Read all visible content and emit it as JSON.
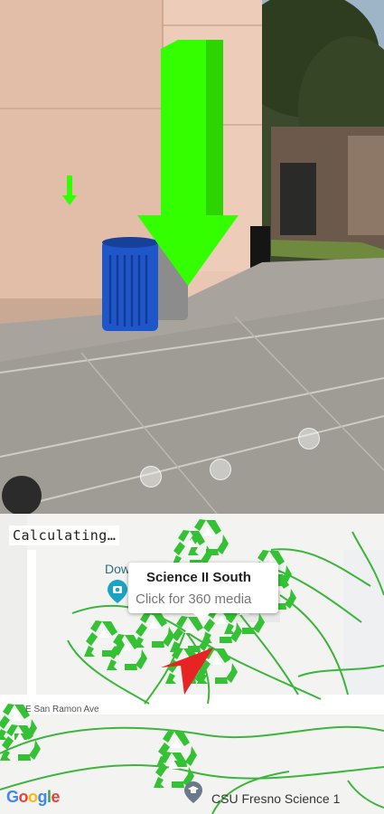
{
  "ar_view": {
    "status_text": "Calculating…",
    "direction_arrow_color": "#33ff00",
    "ar_markers": 3
  },
  "map": {
    "selected_marker": {
      "title": "Science II South",
      "subtitle": "Click for 360 media"
    },
    "poi_downtown": "Dow",
    "poi_csu": "CSU Fresno Science 1",
    "street_label": "E San Ramon Ave",
    "google_letters": [
      "G",
      "o",
      "o",
      "g",
      "l",
      "e"
    ],
    "recycle_color": "#34c234",
    "route_color": "#3cb53c",
    "user_arrow_color": "#e82323"
  }
}
